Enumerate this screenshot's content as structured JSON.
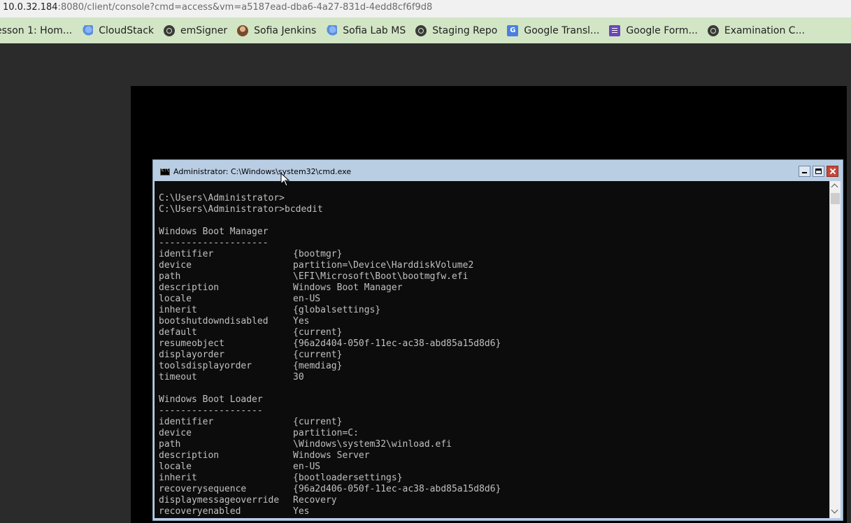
{
  "browser": {
    "url_host": "10.0.32.184",
    "url_rest": ":8080/client/console?cmd=access&vm=a5187ead-dba6-4a27-831d-4edd8cf6f9d8",
    "bookmarks": [
      {
        "label": "esson 1: Hom...",
        "icon": "page-icon"
      },
      {
        "label": "CloudStack",
        "icon": "cloud-icon"
      },
      {
        "label": "emSigner",
        "icon": "globe-icon"
      },
      {
        "label": "Sofia Jenkins",
        "icon": "avatar-icon"
      },
      {
        "label": "Sofia Lab MS",
        "icon": "cloud-icon"
      },
      {
        "label": "Staging Repo",
        "icon": "globe-icon"
      },
      {
        "label": "Google Transl...",
        "icon": "google-translate-icon"
      },
      {
        "label": "Google Form...",
        "icon": "google-forms-icon"
      },
      {
        "label": "Examination C...",
        "icon": "globe-icon"
      }
    ]
  },
  "cmd_window": {
    "title": "Administrator: C:\\Windows\\system32\\cmd.exe"
  },
  "console": {
    "prompt1": "C:\\Users\\Administrator>",
    "prompt2": "C:\\Users\\Administrator>bcdedit",
    "sections": [
      {
        "header": "Windows Boot Manager",
        "rule": "--------------------",
        "rows": [
          [
            "identifier",
            "{bootmgr}"
          ],
          [
            "device",
            "partition=\\Device\\HarddiskVolume2"
          ],
          [
            "path",
            "\\EFI\\Microsoft\\Boot\\bootmgfw.efi"
          ],
          [
            "description",
            "Windows Boot Manager"
          ],
          [
            "locale",
            "en-US"
          ],
          [
            "inherit",
            "{globalsettings}"
          ],
          [
            "bootshutdowndisabled",
            "Yes"
          ],
          [
            "default",
            "{current}"
          ],
          [
            "resumeobject",
            "{96a2d404-050f-11ec-ac38-abd85a15d8d6}"
          ],
          [
            "displayorder",
            "{current}"
          ],
          [
            "toolsdisplayorder",
            "{memdiag}"
          ],
          [
            "timeout",
            "30"
          ]
        ]
      },
      {
        "header": "Windows Boot Loader",
        "rule": "-------------------",
        "rows": [
          [
            "identifier",
            "{current}"
          ],
          [
            "device",
            "partition=C:"
          ],
          [
            "path",
            "\\Windows\\system32\\winload.efi"
          ],
          [
            "description",
            "Windows Server"
          ],
          [
            "locale",
            "en-US"
          ],
          [
            "inherit",
            "{bootloadersettings}"
          ],
          [
            "recoverysequence",
            "{96a2d406-050f-11ec-ac38-abd85a15d8d6}"
          ],
          [
            "displaymessageoverride",
            "Recovery"
          ],
          [
            "recoveryenabled",
            "Yes"
          ]
        ]
      }
    ]
  }
}
